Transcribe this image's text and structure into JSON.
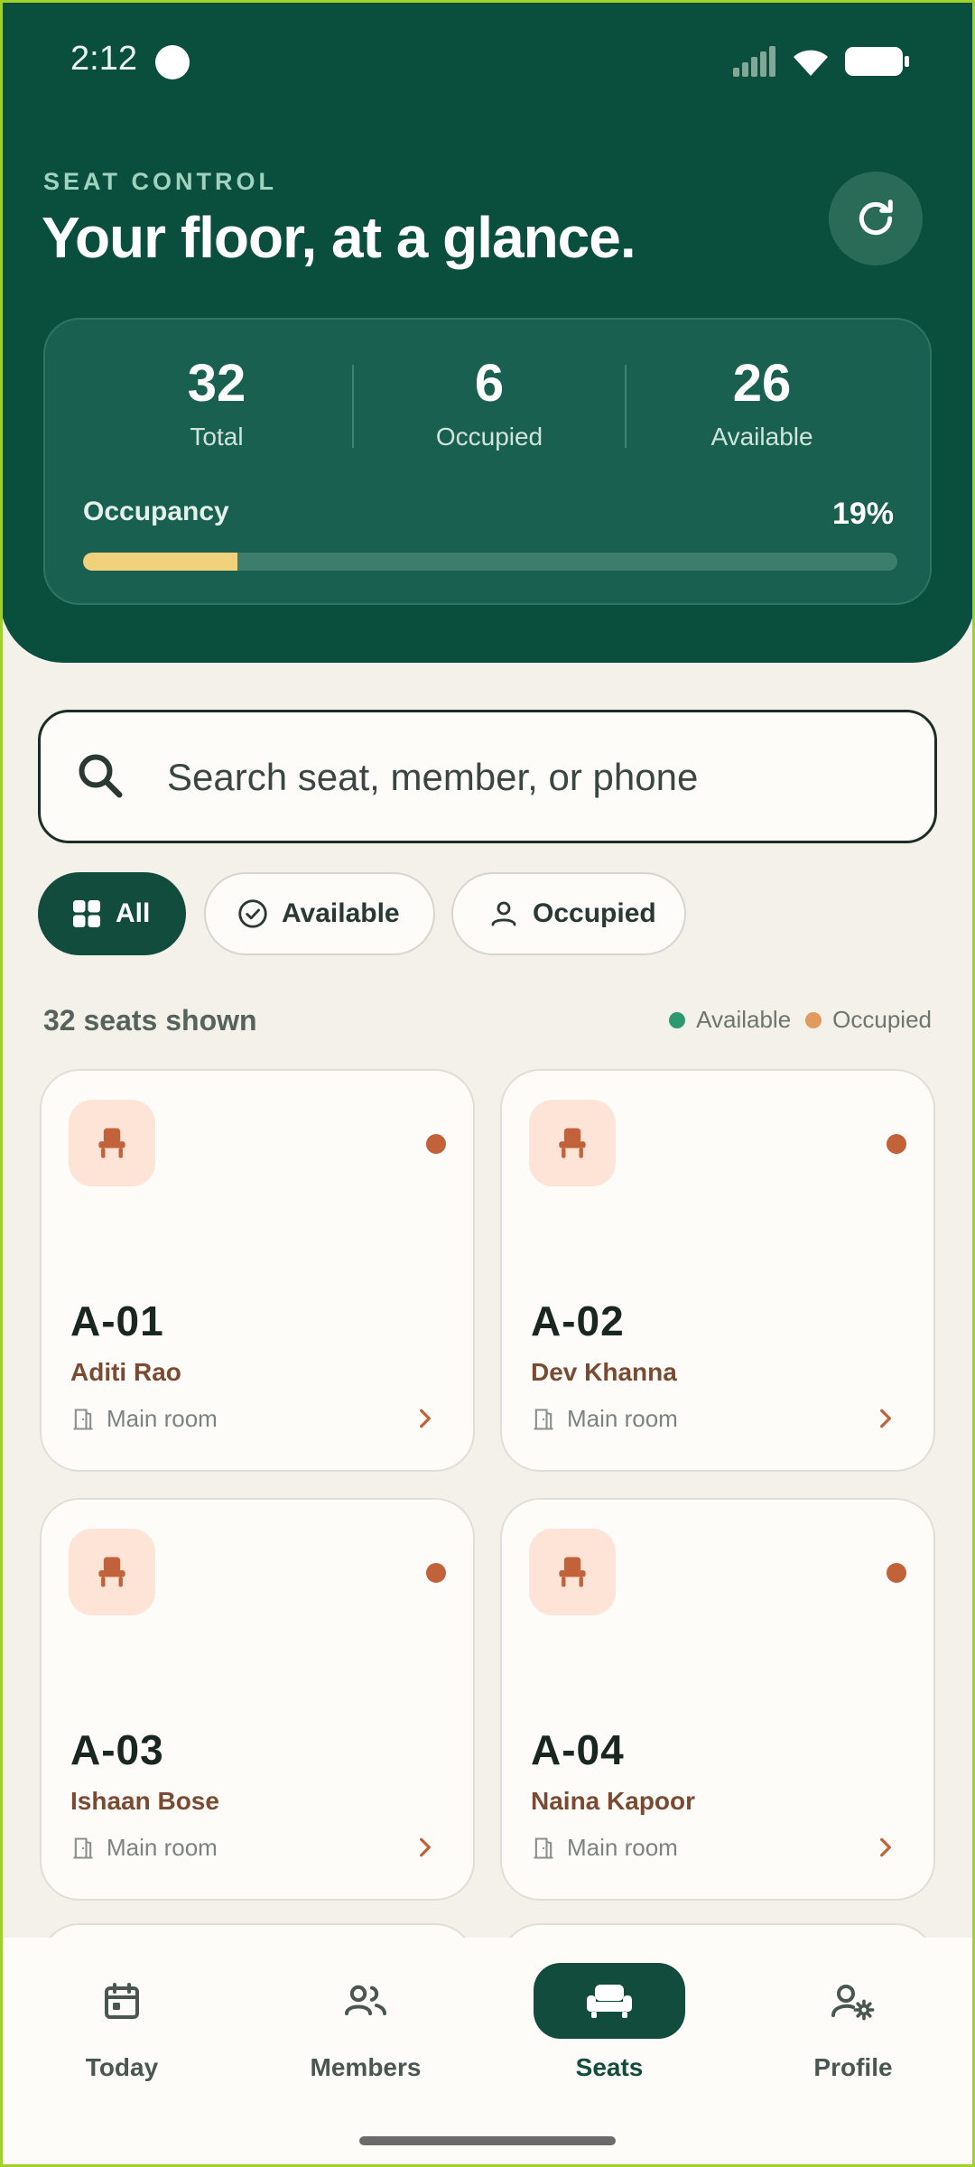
{
  "status_bar": {
    "time": "2:12"
  },
  "header": {
    "eyebrow": "SEAT CONTROL",
    "title": "Your floor, at a glance.",
    "refresh_icon": "refresh-icon"
  },
  "stats": {
    "total": {
      "value": "32",
      "label": "Total"
    },
    "occupied": {
      "value": "6",
      "label": "Occupied"
    },
    "available": {
      "value": "26",
      "label": "Available"
    },
    "occupancy_label": "Occupancy",
    "occupancy_value": "19%",
    "occupancy_fraction": 0.19
  },
  "search": {
    "placeholder": "Search seat, member, or phone",
    "value": ""
  },
  "filters": [
    {
      "label": "All",
      "icon": "grid-icon",
      "active": true
    },
    {
      "label": "Available",
      "icon": "check-circle-icon",
      "active": false
    },
    {
      "label": "Occupied",
      "icon": "person-icon",
      "active": false
    }
  ],
  "list_summary": {
    "count_text": "32 seats shown",
    "legend": [
      {
        "label": "Available",
        "color": "#2b9a73"
      },
      {
        "label": "Occupied",
        "color": "#e39a5e"
      }
    ]
  },
  "seats": [
    {
      "code": "A-01",
      "member": "Aditi Rao",
      "room": "Main room",
      "status": "occupied"
    },
    {
      "code": "A-02",
      "member": "Dev Khanna",
      "room": "Main room",
      "status": "occupied"
    },
    {
      "code": "A-03",
      "member": "Ishaan Bose",
      "room": "Main room",
      "status": "occupied"
    },
    {
      "code": "A-04",
      "member": "Naina Kapoor",
      "room": "Main room",
      "status": "occupied"
    }
  ],
  "nav": {
    "items": [
      {
        "label": "Today",
        "icon": "calendar-icon",
        "active": false
      },
      {
        "label": "Members",
        "icon": "people-icon",
        "active": false
      },
      {
        "label": "Seats",
        "icon": "sofa-icon",
        "active": true
      },
      {
        "label": "Profile",
        "icon": "profile-settings-icon",
        "active": false
      }
    ]
  },
  "colors": {
    "header_bg": "#0a4f3e",
    "accent_yellow": "#f2d17d",
    "occupied_dot": "#c2623a",
    "seat_badge_bg": "#fde4d6"
  }
}
